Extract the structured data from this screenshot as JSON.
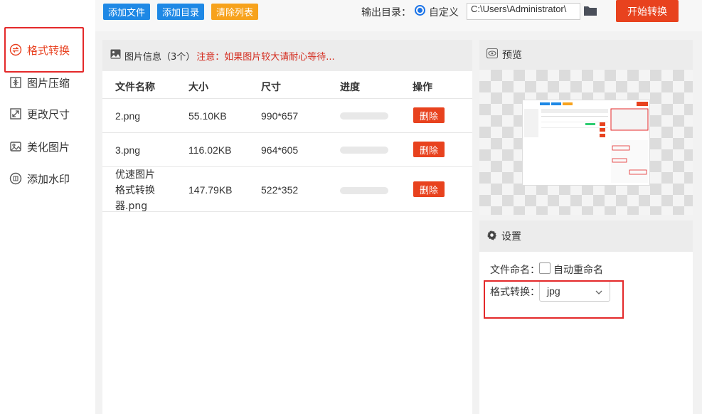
{
  "sidebar": {
    "items": [
      {
        "label": "格式转换",
        "icon": "format-convert-icon"
      },
      {
        "label": "图片压缩",
        "icon": "compress-icon"
      },
      {
        "label": "更改尺寸",
        "icon": "resize-icon"
      },
      {
        "label": "美化图片",
        "icon": "beautify-icon"
      },
      {
        "label": "添加水印",
        "icon": "watermark-icon"
      }
    ]
  },
  "toolbar": {
    "add_file": "添加文件",
    "add_folder": "添加目录",
    "clear_list": "清除列表",
    "output_label": "输出目录：",
    "radio_label": "自定义",
    "output_path": "C:\\Users\\Administrator\\",
    "start_button": "开始转换"
  },
  "file_panel": {
    "title": "图片信息（3个）",
    "warning": "注意：如果图片较大请耐心等待...",
    "columns": [
      "文件名称",
      "大小",
      "尺寸",
      "进度",
      "操作"
    ],
    "rows": [
      {
        "name": "2.png",
        "size": "55.10KB",
        "dims": "990*657",
        "action": "删除"
      },
      {
        "name": "3.png",
        "size": "116.02KB",
        "dims": "964*605",
        "action": "删除"
      },
      {
        "name": "优速图片格式转换器.png",
        "size": "147.79KB",
        "dims": "522*352",
        "action": "删除"
      }
    ],
    "row3_lines": [
      "优速图片",
      "格式转换",
      "器.png"
    ]
  },
  "preview": {
    "title": "预览"
  },
  "settings": {
    "title": "设置",
    "naming_label": "文件命名：",
    "auto_rename": "自动重命名",
    "format_label": "格式转换：",
    "format_value": "jpg"
  },
  "colors": {
    "accent_red": "#e8421e",
    "blue": "#1e88e5",
    "orange": "#f7a21c",
    "highlight": "#e4292a"
  }
}
